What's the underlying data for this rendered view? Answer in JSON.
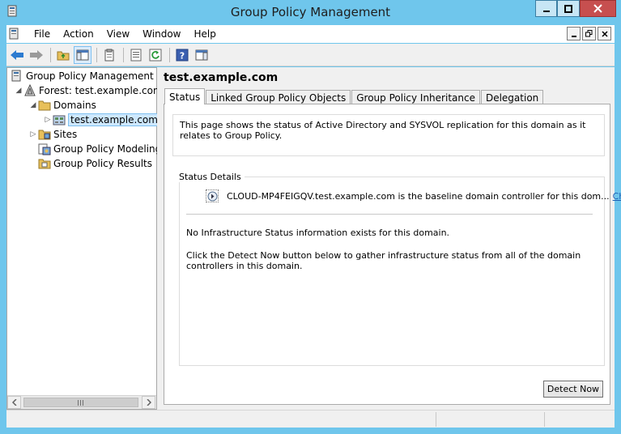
{
  "window": {
    "title": "Group Policy Management"
  },
  "menu": {
    "items": [
      "File",
      "Action",
      "View",
      "Window",
      "Help"
    ]
  },
  "tree": {
    "root": "Group Policy Management",
    "forest": "Forest: test.example.com",
    "domains": "Domains",
    "domain": "test.example.com",
    "sites": "Sites",
    "modeling": "Group Policy Modeling",
    "results": "Group Policy Results"
  },
  "details": {
    "title": "test.example.com",
    "tabs": [
      "Status",
      "Linked Group Policy Objects",
      "Group Policy Inheritance",
      "Delegation"
    ],
    "active_tab": "Status",
    "info_text": "This page shows the status of Active Directory and SYSVOL replication for this domain as it relates to Group Policy.",
    "status_details_label": "Status Details",
    "baseline_text": "CLOUD-MP4FEIGQV.test.example.com is the baseline domain controller for this dom...",
    "change_link": "Change",
    "no_info_text": "No Infrastructure Status information exists for this domain.",
    "detect_instructions": "Click the Detect Now button below to gather infrastructure status from all of the domain controllers in this domain.",
    "detect_button": "Detect Now"
  },
  "colors": {
    "frame": "#6fc6ec",
    "close_button": "#c74f4f",
    "link": "#1a5fb4",
    "selection": "#cde8ff"
  }
}
